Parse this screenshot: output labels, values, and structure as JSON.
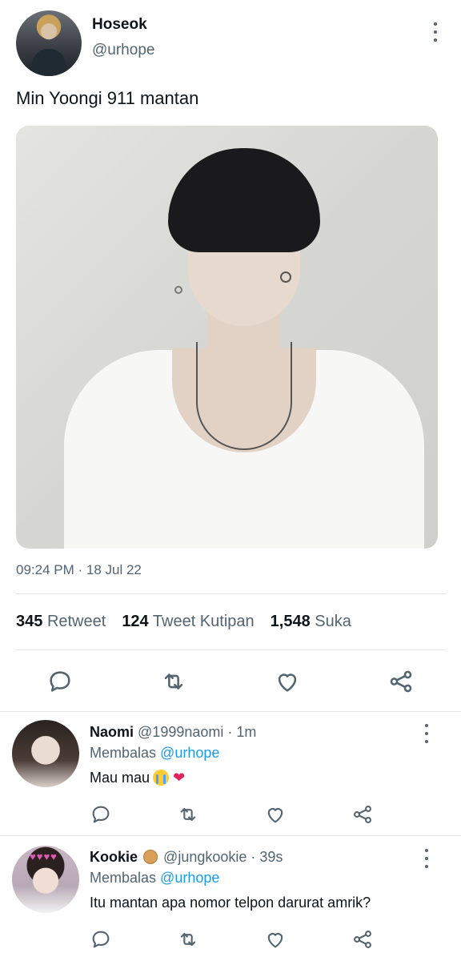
{
  "tweet": {
    "author_name": "Hoseok",
    "author_handle": "@urhope",
    "text": "Min Yoongi 911 mantan",
    "timestamp": "09:24 PM · 18 Jul 22"
  },
  "stats": {
    "retweets_count": "345",
    "retweets_label": "Retweet",
    "quotes_count": "124",
    "quotes_label": "Tweet Kutipan",
    "likes_count": "1,548",
    "likes_label": "Suka"
  },
  "icons": {
    "reply": "reply-icon",
    "retweet": "retweet-icon",
    "like": "heart-icon",
    "share": "share-icon",
    "more": "more-vertical-icon"
  },
  "replies": [
    {
      "name": "Naomi",
      "handle": "@1999naomi",
      "time": "· 1m",
      "replying_label": "Membalas",
      "replying_to": "@urhope",
      "text": "Mau mau"
    },
    {
      "name": "Kookie",
      "handle": "@jungkookie",
      "time": "· 39s",
      "replying_label": "Membalas",
      "replying_to": "@urhope",
      "text": "Itu mantan apa nomor telpon darurat amrik?"
    }
  ],
  "colors": {
    "link": "#1d9bf0",
    "secondary_text": "#536471",
    "primary_text": "#0f1419"
  }
}
